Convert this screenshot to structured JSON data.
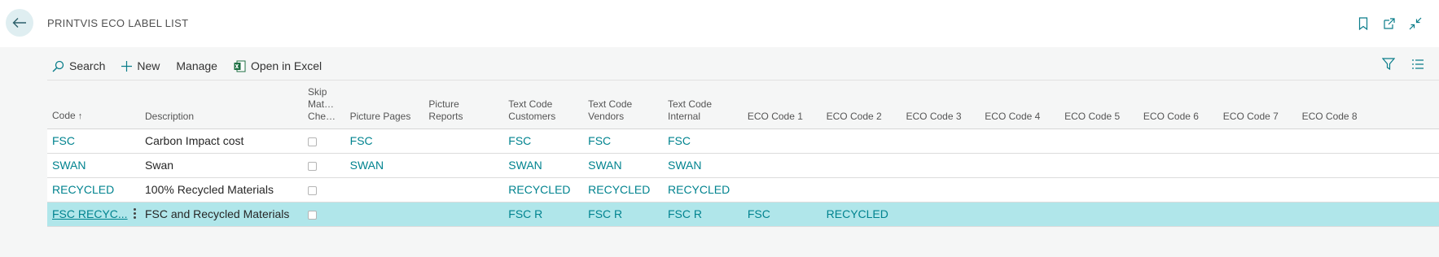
{
  "page": {
    "title": "PRINTVIS ECO LABEL LIST"
  },
  "toolbar": {
    "search_label": "Search",
    "new_label": "New",
    "manage_label": "Manage",
    "excel_label": "Open in Excel"
  },
  "columns": {
    "code": "Code",
    "code_sort": "↑",
    "description": "Description",
    "skip_1": "Skip",
    "skip_2": "Mat…",
    "skip_3": "Che…",
    "picture_pages": "Picture Pages",
    "picture_reports_1": "Picture",
    "picture_reports_2": "Reports",
    "text_customers_1": "Text Code",
    "text_customers_2": "Customers",
    "text_vendors_1": "Text Code",
    "text_vendors_2": "Vendors",
    "text_internal_1": "Text Code",
    "text_internal_2": "Internal",
    "eco1": "ECO Code 1",
    "eco2": "ECO Code 2",
    "eco3": "ECO Code 3",
    "eco4": "ECO Code 4",
    "eco5": "ECO Code 5",
    "eco6": "ECO Code 6",
    "eco7": "ECO Code 7",
    "eco8": "ECO Code 8"
  },
  "rows": [
    {
      "code": "FSC",
      "description": "Carbon Impact cost",
      "picture_pages": "FSC",
      "text_customers": "FSC",
      "text_vendors": "FSC",
      "text_internal": "FSC",
      "eco1": "",
      "eco2": ""
    },
    {
      "code": "SWAN",
      "description": "Swan",
      "picture_pages": "SWAN",
      "text_customers": "SWAN",
      "text_vendors": "SWAN",
      "text_internal": "SWAN",
      "eco1": "",
      "eco2": ""
    },
    {
      "code": "RECYCLED",
      "description": "100% Recycled Materials",
      "picture_pages": "",
      "text_customers": "RECYCLED",
      "text_vendors": "RECYCLED",
      "text_internal": "RECYCLED",
      "eco1": "",
      "eco2": ""
    },
    {
      "code": "FSC RECYC...",
      "description": "FSC and Recycled Materials",
      "picture_pages": "",
      "text_customers": "FSC R",
      "text_vendors": "FSC R",
      "text_internal": "FSC R",
      "eco1": "FSC",
      "eco2": "RECYCLED"
    }
  ],
  "selected_row": 3,
  "colors": {
    "accent": "#00838f",
    "selected_row": "#b0e6ea",
    "excel_green": "#1d6f42"
  }
}
